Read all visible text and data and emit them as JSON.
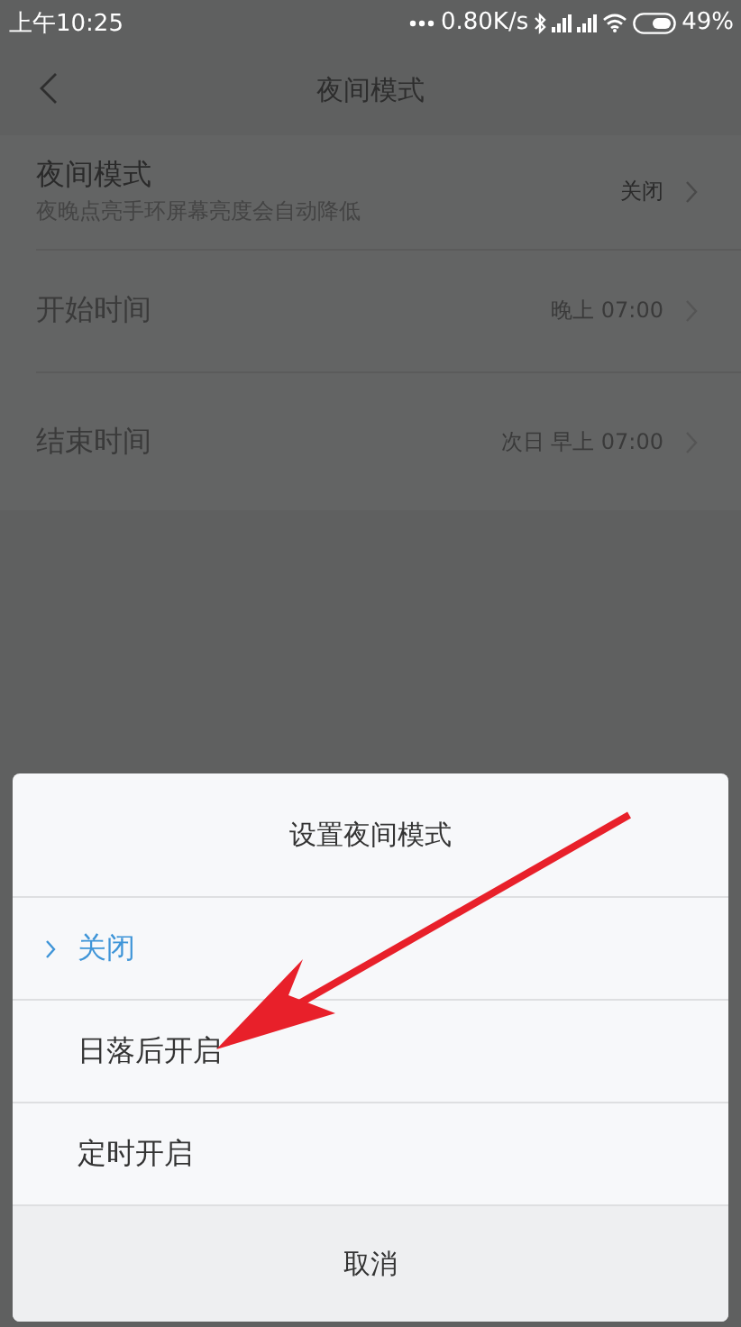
{
  "status_bar": {
    "time": "上午10:25",
    "speed": "0.80K/s",
    "battery": "49%"
  },
  "header": {
    "title": "夜间模式"
  },
  "settings": [
    {
      "title": "夜间模式",
      "subtitle": "夜晚点亮手环屏幕亮度会自动降低",
      "value": "关闭",
      "disabled": false
    },
    {
      "title": "开始时间",
      "value": "晚上 07:00",
      "disabled": true
    },
    {
      "title": "结束时间",
      "value": "次日 早上 07:00",
      "disabled": true
    }
  ],
  "dialog": {
    "title": "设置夜间模式",
    "options": [
      {
        "label": "关闭",
        "selected": true
      },
      {
        "label": "日落后开启",
        "selected": false
      },
      {
        "label": "定时开启",
        "selected": false
      }
    ],
    "cancel": "取消"
  }
}
